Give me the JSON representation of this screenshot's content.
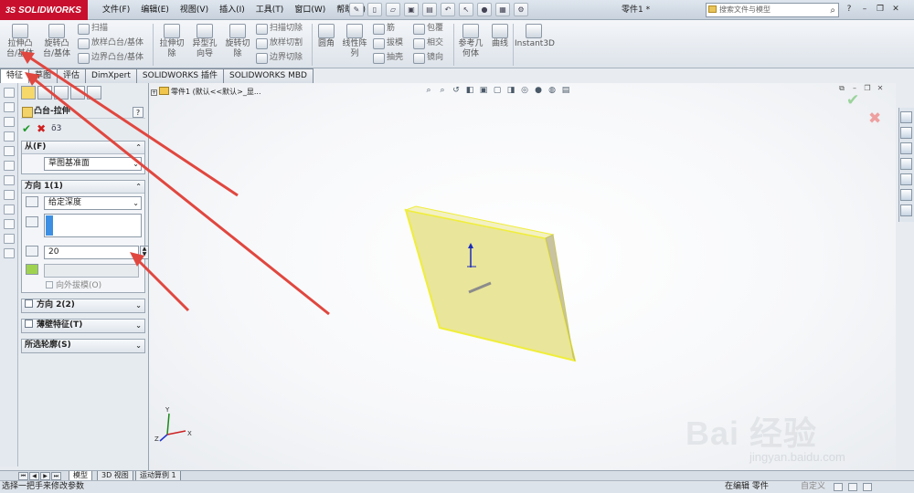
{
  "app": {
    "brand": "SOLIDWORKS",
    "brand_mark": "3S",
    "document_title": "零件1 *"
  },
  "menu": [
    "文件(F)",
    "编辑(E)",
    "视图(V)",
    "插入(I)",
    "工具(T)",
    "窗口(W)",
    "帮助(H)"
  ],
  "search": {
    "placeholder": "搜索文件与模型"
  },
  "ribbon": {
    "extrude_boss": "拉伸凸\n台/基体",
    "revolve_boss": "旋转凸\n台/基体",
    "sweep": "扫描",
    "loft": "放样凸台/基体",
    "boundary_boss": "边界凸台/基体",
    "extrude_cut": "拉伸切\n除",
    "hole_wizard": "异型孔\n向导",
    "revolve_cut": "旋转切\n除",
    "sweep_cut": "扫描切除",
    "loft_cut": "放样切割",
    "boundary_cut": "边界切除",
    "fillet": "圆角",
    "linear_pattern": "线性阵\n列",
    "rib": "筋",
    "draft": "拔模",
    "shell": "抽壳",
    "wrap": "包覆",
    "intersect": "相交",
    "mirror": "镜向",
    "ref_geometry": "参考几\n何体",
    "curves": "曲线",
    "instant3d": "Instant3D"
  },
  "tabs": [
    "特征",
    "草图",
    "评估",
    "DimXpert",
    "SOLIDWORKS 插件",
    "SOLIDWORKS MBD"
  ],
  "property_manager": {
    "title": "凸台-拉伸",
    "help": "?",
    "from": {
      "header": "从(F)",
      "value": "草图基准面"
    },
    "direction1": {
      "header": "方向 1(1)",
      "end_condition": "给定深度",
      "depth": "20",
      "draft_outward": "向外拔模(O)"
    },
    "direction2": {
      "header": "方向 2(2)"
    },
    "thin_feature": {
      "header": "薄壁特征(T)"
    },
    "selected_contours": {
      "header": "所选轮廓(S)"
    }
  },
  "tree": {
    "root_label": "零件1 (默认<<默认>_显..."
  },
  "bottom_tabs": [
    "模型",
    "3D 视图",
    "运动算例 1"
  ],
  "status": {
    "left": "选择一把手来修改参数",
    "editing": "在编辑 零件",
    "custom": "自定义"
  },
  "watermark": {
    "text": "Bai 经验",
    "url": "jingyan.baidu.com"
  },
  "colors": {
    "brand_red": "#c8102e",
    "ok_green": "#1f9a2a",
    "cancel_red": "#d02020",
    "part_face": "#ece9a8",
    "part_edge": "#f0ee3a",
    "arrow_red": "#e0473f"
  }
}
